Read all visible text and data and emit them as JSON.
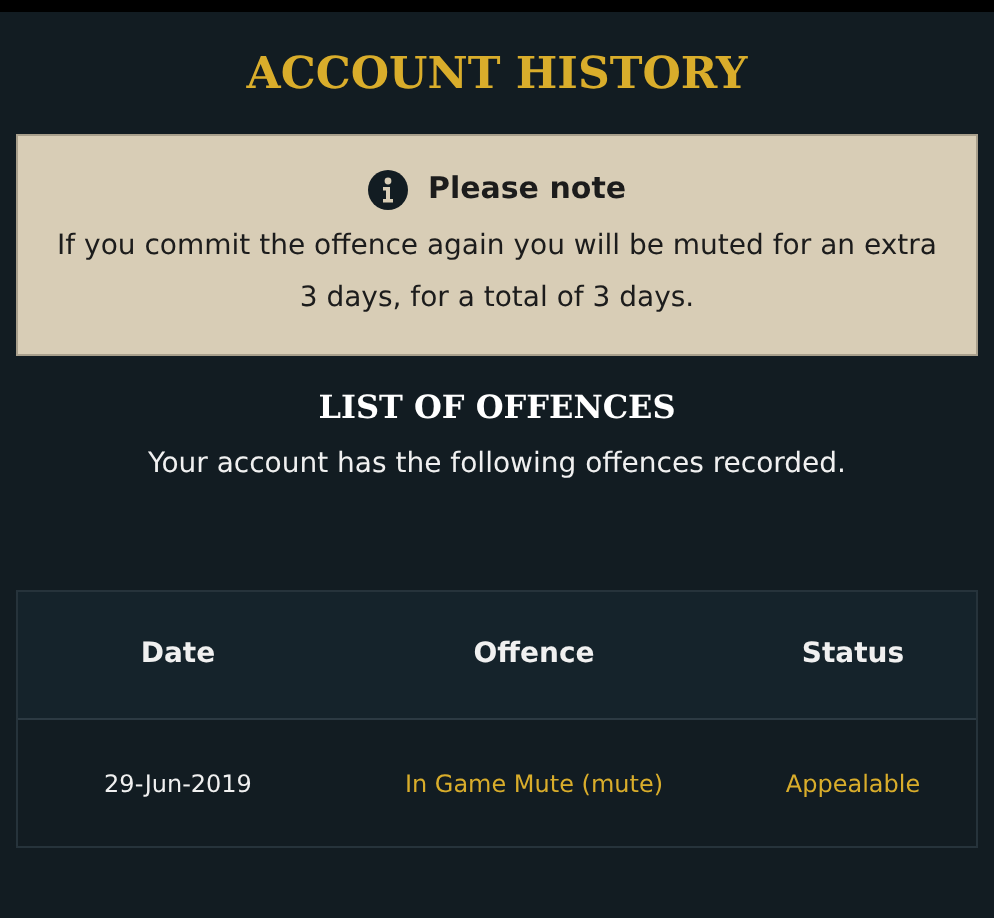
{
  "title": "ACCOUNT HISTORY",
  "note": {
    "heading": "Please note",
    "text": "If you commit the offence again you will be muted for an extra 3 days, for a total of 3 days."
  },
  "section": {
    "title": "LIST OF OFFENCES",
    "subtitle": "Your account has the following offences recorded."
  },
  "table": {
    "columns": [
      "Date",
      "Offence",
      "Status"
    ],
    "rows": [
      {
        "date": "29-Jun-2019",
        "offence": "In Game Mute (mute)",
        "status": "Appealable"
      }
    ]
  }
}
